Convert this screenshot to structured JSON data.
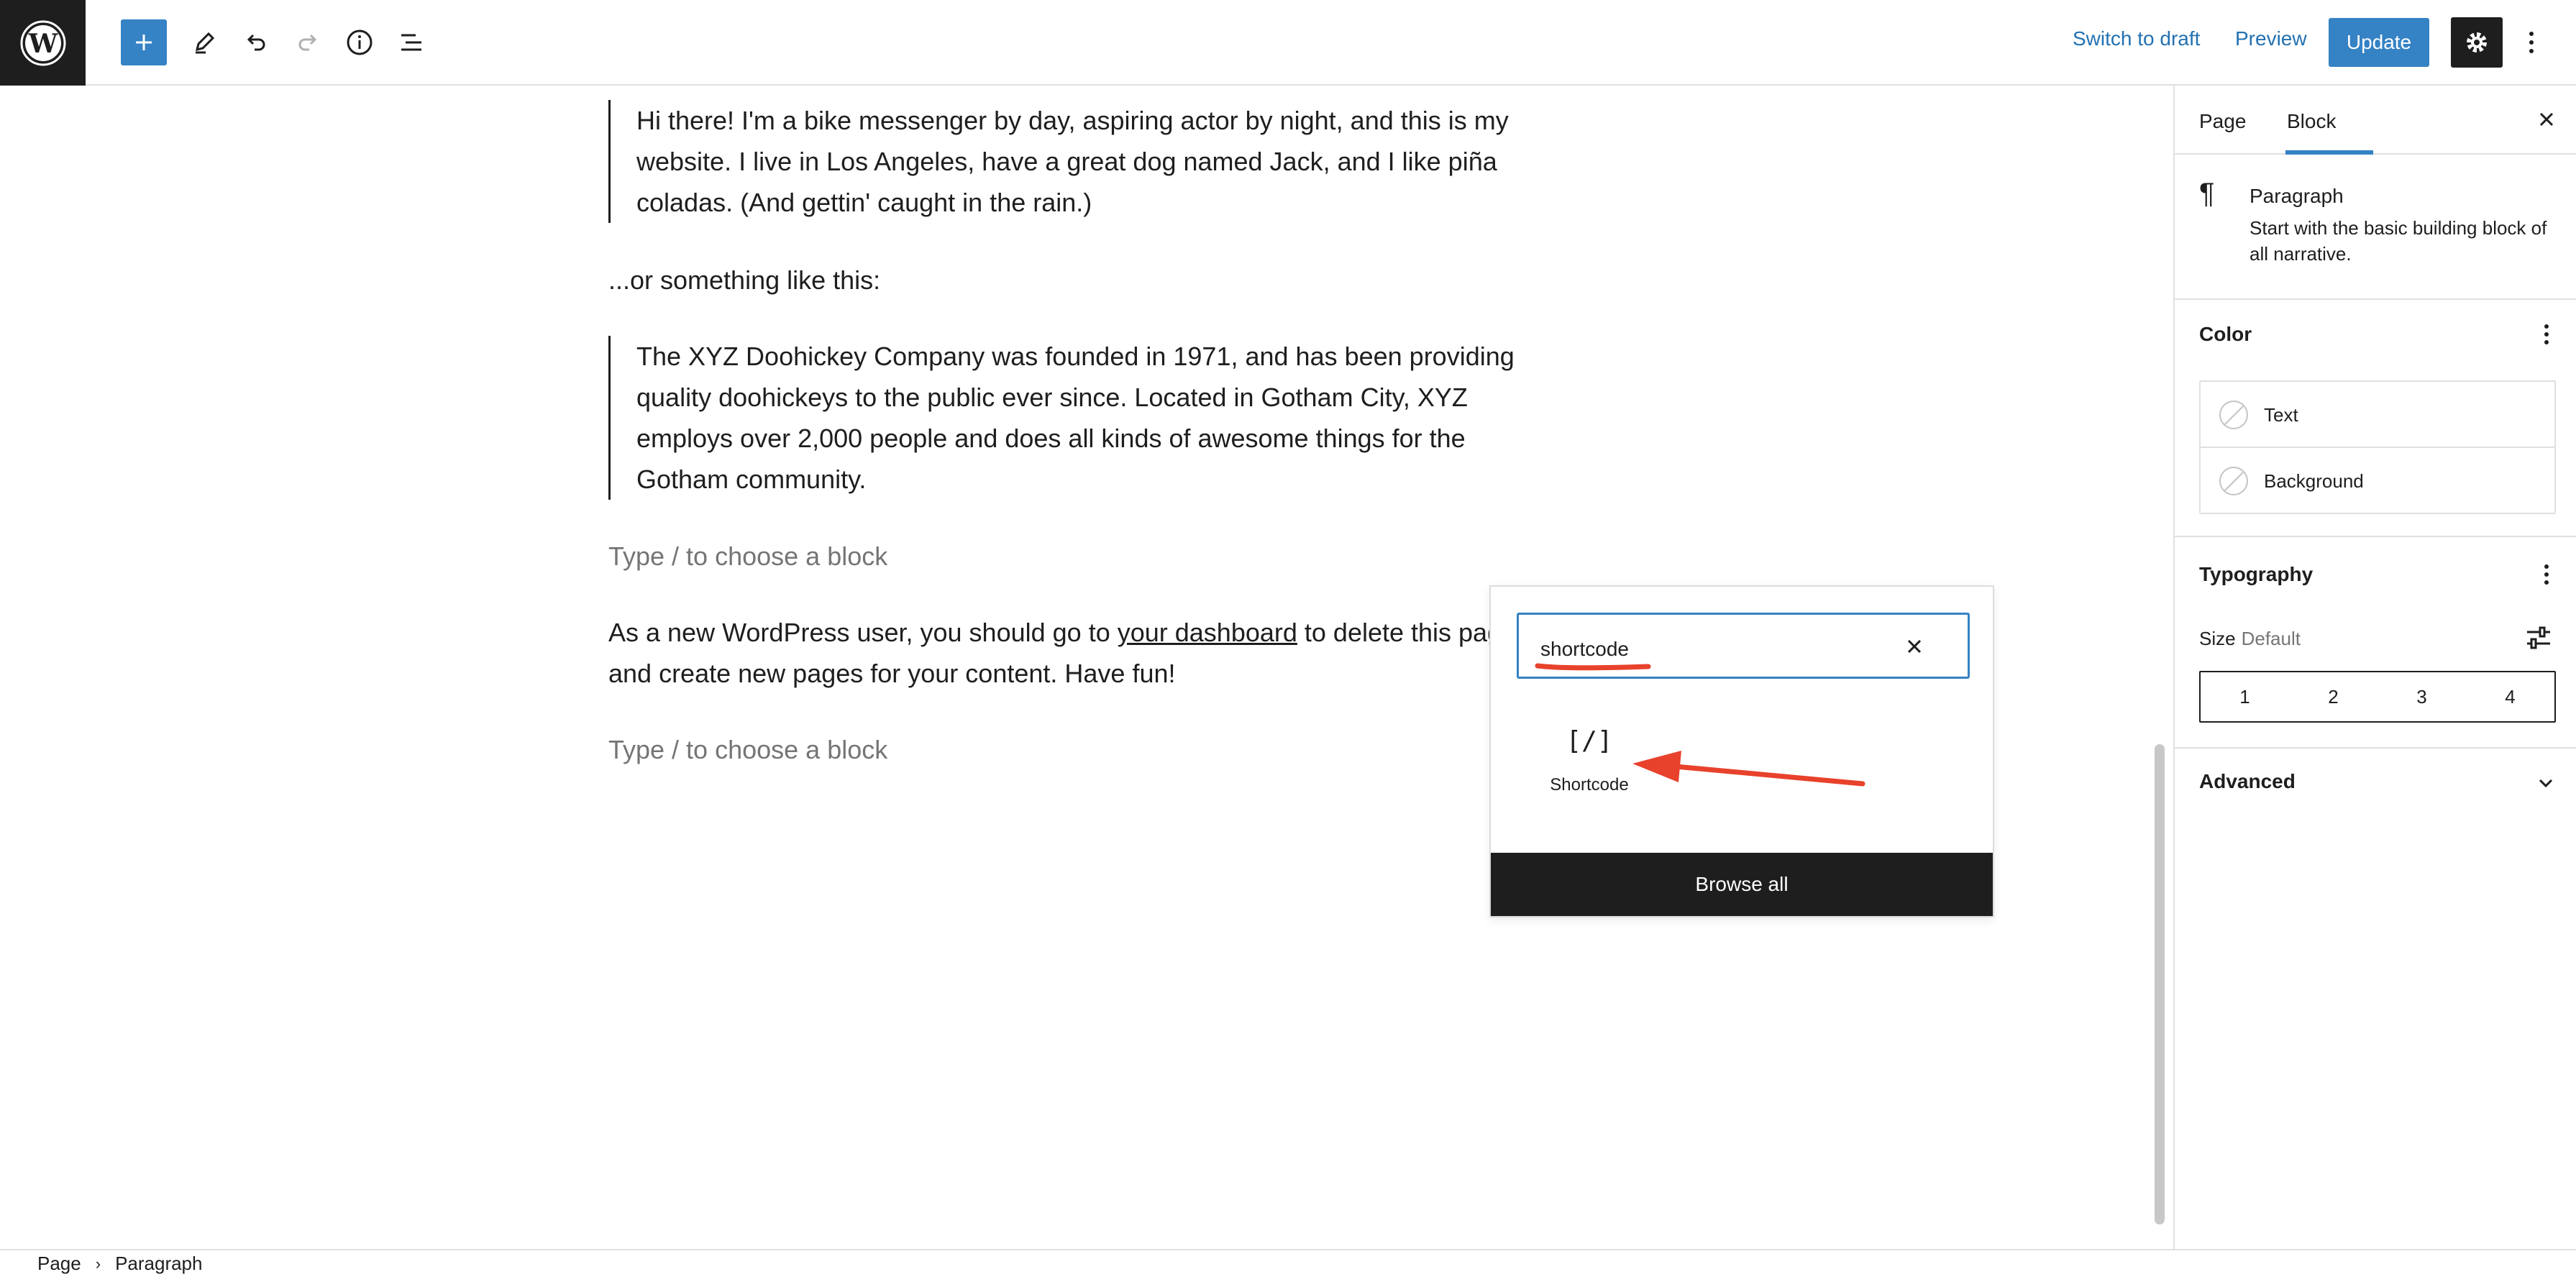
{
  "toolbar": {
    "switch_to_draft": "Switch to draft",
    "preview": "Preview",
    "update": "Update"
  },
  "content": {
    "intro_quote": "Hi there! I'm a bike messenger by day, aspiring actor by night, and this is my website. I live in Los Angeles, have a great dog named Jack, and I like piña coladas. (And gettin' caught in the rain.)",
    "or_something": "...or something like this:",
    "company_quote": "The XYZ Doohickey Company was founded in 1971, and has been providing quality doohickeys to the public ever since. Located in Gotham City, XYZ employs over 2,000 people and does all kinds of awesome things for the Gotham community.",
    "placeholder": "Type / to choose a block",
    "closing_before": "As a new WordPress user, you should go to ",
    "closing_link": "your dashboard",
    "closing_after": " to delete this pag",
    "closing_line2": "and create new pages for your content. Have fun!"
  },
  "inserter": {
    "search_value": "shortcode",
    "result_icon": "[/]",
    "result_label": "Shortcode",
    "browse_all": "Browse all"
  },
  "sidebar": {
    "tabs": [
      "Page",
      "Block"
    ],
    "active_tab": "Block",
    "block_title": "Paragraph",
    "block_description": "Start with the basic building block of all narrative.",
    "color_title": "Color",
    "color_items": [
      "Text",
      "Background"
    ],
    "typography_title": "Typography",
    "size_label": "Size",
    "size_value": "Default",
    "size_options": [
      "1",
      "2",
      "3",
      "4"
    ],
    "advanced_title": "Advanced"
  },
  "footer": {
    "breadcrumb": [
      "Page",
      "Paragraph"
    ]
  },
  "colors": {
    "accent": "#3582c4",
    "dark": "#1e1e1e",
    "annotation": "#e8412c"
  }
}
